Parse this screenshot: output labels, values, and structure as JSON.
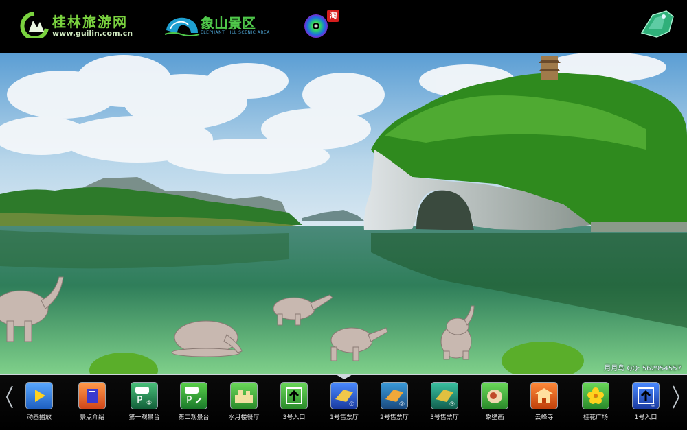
{
  "header": {
    "site_title": "桂林旅游网",
    "site_url": "www.guilin.com.cn",
    "scenic_title": "象山景区",
    "scenic_subtitle": "ELEPHANT HILL SCENIC AREA",
    "taobao_badge": "淘"
  },
  "scene": {
    "credit": "月月鸟  QQ: 562954557"
  },
  "toolbar": {
    "items": [
      {
        "label": "动画播放",
        "icon": "play-icon",
        "color": "#2f7fe0"
      },
      {
        "label": "景点介绍",
        "icon": "book-icon",
        "color": "#e46a2a"
      },
      {
        "label": "第一观景台",
        "icon": "parking-icon",
        "color": "#1e8a55"
      },
      {
        "label": "第二观景台",
        "icon": "parking-icon",
        "color": "#2a9a3a"
      },
      {
        "label": "水月楼餐厅",
        "icon": "restaurant-icon",
        "color": "#3aa84a"
      },
      {
        "label": "3号入口",
        "icon": "entrance-icon",
        "color": "#3aa84a"
      },
      {
        "label": "1号售票厅",
        "icon": "ticket-icon",
        "color": "#2a5fc8"
      },
      {
        "label": "2号售票厅",
        "icon": "ticket-icon",
        "color": "#2a6ea8"
      },
      {
        "label": "3号售票厅",
        "icon": "ticket-icon",
        "color": "#1e8a6a"
      },
      {
        "label": "象壁画",
        "icon": "mural-icon",
        "color": "#3aa84a"
      },
      {
        "label": "云峰寺",
        "icon": "temple-icon",
        "color": "#e05a22"
      },
      {
        "label": "桂花广场",
        "icon": "flower-icon",
        "color": "#3aa84a"
      },
      {
        "label": "1号入口",
        "icon": "entrance-icon",
        "color": "#2a5fc8"
      }
    ],
    "badge_1": "①",
    "badge_2": "②",
    "badge_3": "③"
  }
}
